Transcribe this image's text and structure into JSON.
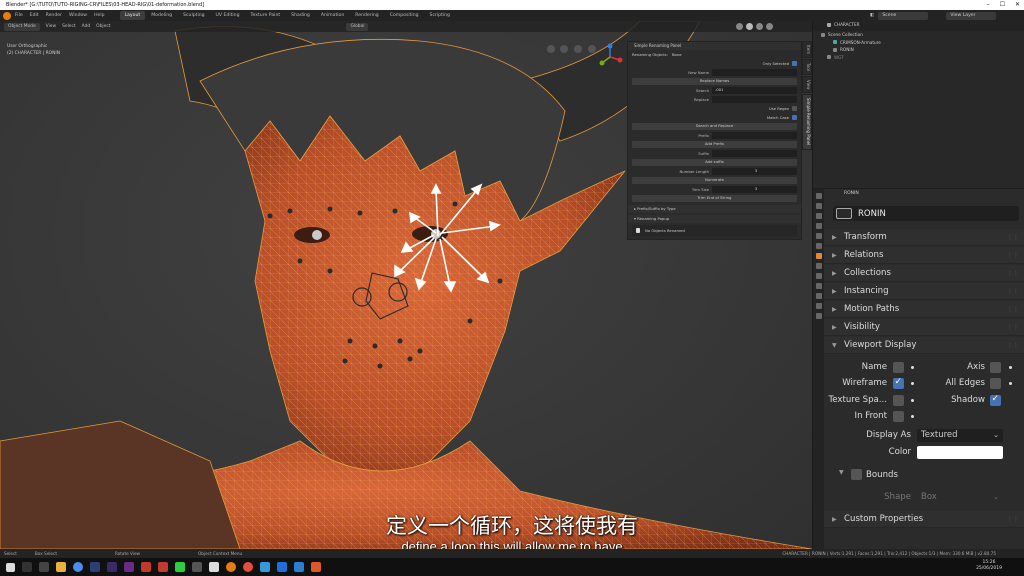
{
  "titlebar": {
    "title": "Blender* [G:\\TUTO\\TUTO-RIGING-CR\\FILES\\03-HEAD-RIG\\01-deformation.blend]",
    "min": "–",
    "max": "☐",
    "close": "✕"
  },
  "topbar": {
    "menu": [
      "File",
      "Edit",
      "Render",
      "Window",
      "Help"
    ],
    "tabs": [
      "Layout",
      "Modeling",
      "Sculpting",
      "UV Editing",
      "Texture Paint",
      "Shading",
      "Animation",
      "Rendering",
      "Compositing",
      "Scripting"
    ],
    "active_tab": "Layout",
    "scene_label": "Scene",
    "view_layer_label": "View Layer"
  },
  "viewport": {
    "mode": "Object Mode",
    "menu": [
      "View",
      "Select",
      "Add",
      "Object"
    ],
    "orientation": "Global",
    "view_name": "User Orthographic",
    "object_info": "(2) CHARACTER | RONIN"
  },
  "renaming_panel": {
    "title": "Simple Renaming Panel",
    "renaming_objects_label": "Renaming Objects:",
    "renaming_objects_value": "Bone",
    "only_selected": "Only Selected",
    "new_name": "New Name",
    "replace_names": "Replace Names",
    "search": "Search",
    "search_value": ".001",
    "replace": "Replace",
    "use_regex": "Use Regex",
    "match_case": "Match Case",
    "search_and_replace": "Search and Replace",
    "prefix": "Prefix",
    "add_prefix": "Add Prefix",
    "suffix": "Suffix",
    "add_suffix": "Add suffix",
    "number_length": "Number Length",
    "number_length_value": "3",
    "numerate": "Numerate",
    "trim_size": "Trim Size",
    "trim_size_value": "3",
    "trim_end": "Trim End of String",
    "prefix_suffix_by_type": "Prefix/Suffix by Type",
    "renaming_popup": "Renaming Popup",
    "no_objects": "No Objects Renamed"
  },
  "side_tabs": [
    "Item",
    "Tool",
    "View",
    "Simple Renaming Panel"
  ],
  "outliner": {
    "rows": [
      "Scene Collection",
      "CHARACTER",
      "CRIMSON-Armature",
      "RONIN",
      "WGT"
    ]
  },
  "properties": {
    "header": "RONIN",
    "object_name": "RONIN",
    "sections": [
      "Transform",
      "Relations",
      "Collections",
      "Instancing",
      "Motion Paths",
      "Visibility",
      "Viewport Display"
    ],
    "viewport_display": {
      "name": "Name",
      "axis": "Axis",
      "wireframe": "Wireframe",
      "all_edges": "All Edges",
      "texture_space": "Texture Spa...",
      "shadow": "Shadow",
      "in_front": "In Front",
      "display_as_label": "Display As",
      "display_as_value": "Textured",
      "color_label": "Color",
      "bounds": "Bounds",
      "shape_label": "Shape",
      "shape_value": "Box"
    },
    "custom_properties": "Custom Properties"
  },
  "statusbar": {
    "select": "Select",
    "box_select": "Box Select",
    "rotate_view": "Rotate View",
    "context_menu": "Object Context Menu",
    "stats": "CHARACTER | RONIN | Verts:1,291 | Faces:1,291 | Tris:2,412 | Objects:1/3 | Mem: 330.6 MiB | v2.80.75"
  },
  "subtitles": {
    "zh": "定义一个循环，这将使我有",
    "en": "define a loop this will allow me to have"
  },
  "clock": {
    "time": "15:26",
    "date": "25/06/2019"
  },
  "colors": {
    "accent": "#e87d0d",
    "select_blue": "#4772b3",
    "skin": "#c8562c"
  }
}
